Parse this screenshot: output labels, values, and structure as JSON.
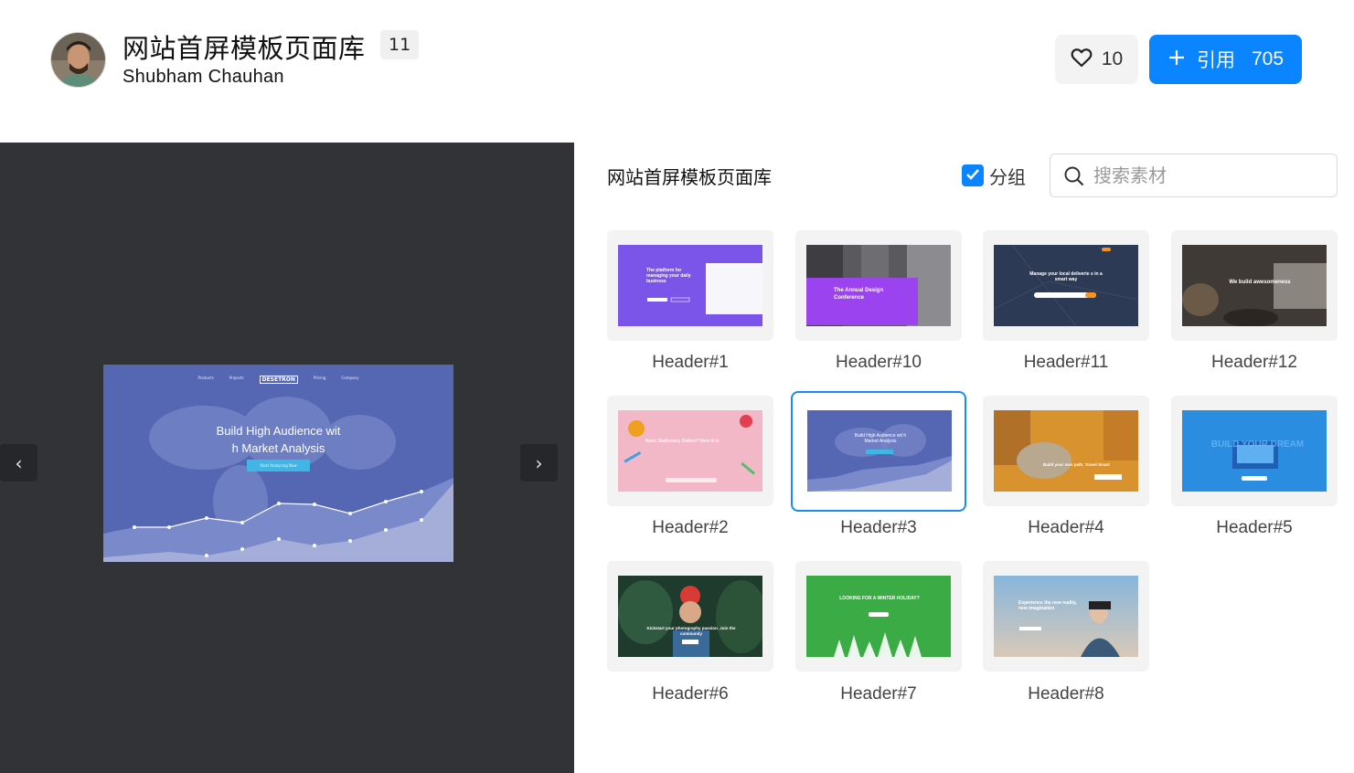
{
  "header": {
    "title": "网站首屏模板页面库",
    "count": "11",
    "author": "Shubham Chauhan",
    "likes": "10",
    "cite_label": "引用",
    "cite_count": "705"
  },
  "preview": {
    "nav": [
      "Products",
      "Projects",
      "DESETRON",
      "Pricing",
      "Company"
    ],
    "headline_line1": "Build High Audience wit",
    "headline_line2": "h Market Analysis",
    "cta": "Start Analyzing Now",
    "prev_icon": "‹",
    "next_icon": "›"
  },
  "panel": {
    "title": "网站首屏模板页面库",
    "group_label": "分组",
    "group_checked": true,
    "search_placeholder": "搜索素材"
  },
  "items": [
    {
      "label": "Header#1",
      "thumb_text": "The platform for managing your daily business"
    },
    {
      "label": "Header#10",
      "thumb_text": "The Annual Design Conference"
    },
    {
      "label": "Header#11",
      "thumb_text": "Manage your local deliverie s in a smart way"
    },
    {
      "label": "Header#12",
      "thumb_text": "We build awesomeness"
    },
    {
      "label": "Header#2",
      "thumb_text": "Need Stationary Online? Here it is"
    },
    {
      "label": "Header#3",
      "thumb_text": "Build High Audience wit h Market Analysis"
    },
    {
      "label": "Header#4",
      "thumb_text": "Build your own path. Travel Smart"
    },
    {
      "label": "Header#5",
      "thumb_text": "BUILD YOUR DREAM"
    },
    {
      "label": "Header#6",
      "thumb_text": "Kickstart your photography passion. Join the community"
    },
    {
      "label": "Header#7",
      "thumb_text": "LOOKING FOR A WINTER HOLIDAY?"
    },
    {
      "label": "Header#8",
      "thumb_text": "Experience the new reality, new imagination"
    }
  ],
  "colors": {
    "accent": "#0b84ff",
    "preview_bg": "#323337",
    "selected_border": "#1a8cf0"
  }
}
